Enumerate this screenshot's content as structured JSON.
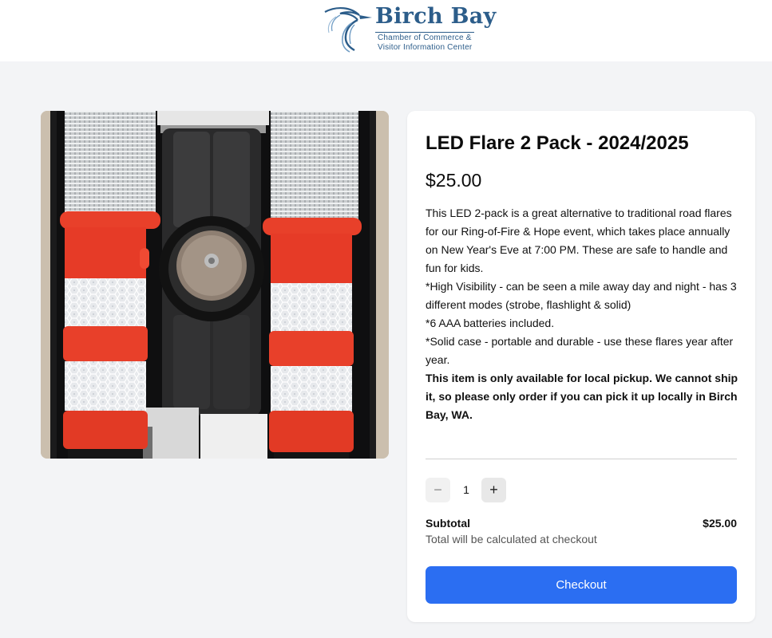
{
  "header": {
    "logo": {
      "name": "Birch Bay",
      "subtitle_line1": "Chamber of Commerce &",
      "subtitle_line2": "Visitor Information Center",
      "icon": "heron-icon",
      "color": "#2c5d8a"
    }
  },
  "product": {
    "title": "LED Flare 2 Pack - 2024/2025",
    "price": "$25.00",
    "image": {
      "icon": "product-photo-led-flares",
      "accent_color": "#e8402a"
    },
    "description": [
      "This LED 2-pack is a great alternative to traditional road flares for our Ring-of-Fire & Hope event, which takes place annually on New Year's Eve at 7:00 PM. These are safe to handle and fun for kids.",
      "*High Visibility - can be seen a mile away day and night - has 3 different modes (strobe, flashlight & solid)",
      "*6 AAA batteries included.",
      "*Solid case - portable and durable - use these flares year after year."
    ],
    "notice": "This item is only available for local pickup. We cannot ship it, so please only order if you can pick it up locally in Birch Bay, WA."
  },
  "cart": {
    "quantity": "1",
    "minus_label": "−",
    "plus_label": "+",
    "subtotal_label": "Subtotal",
    "subtotal_value": "$25.00",
    "subtotal_note": "Total will be calculated at checkout",
    "checkout_label": "Checkout",
    "checkout_color": "#2b6ef2"
  }
}
